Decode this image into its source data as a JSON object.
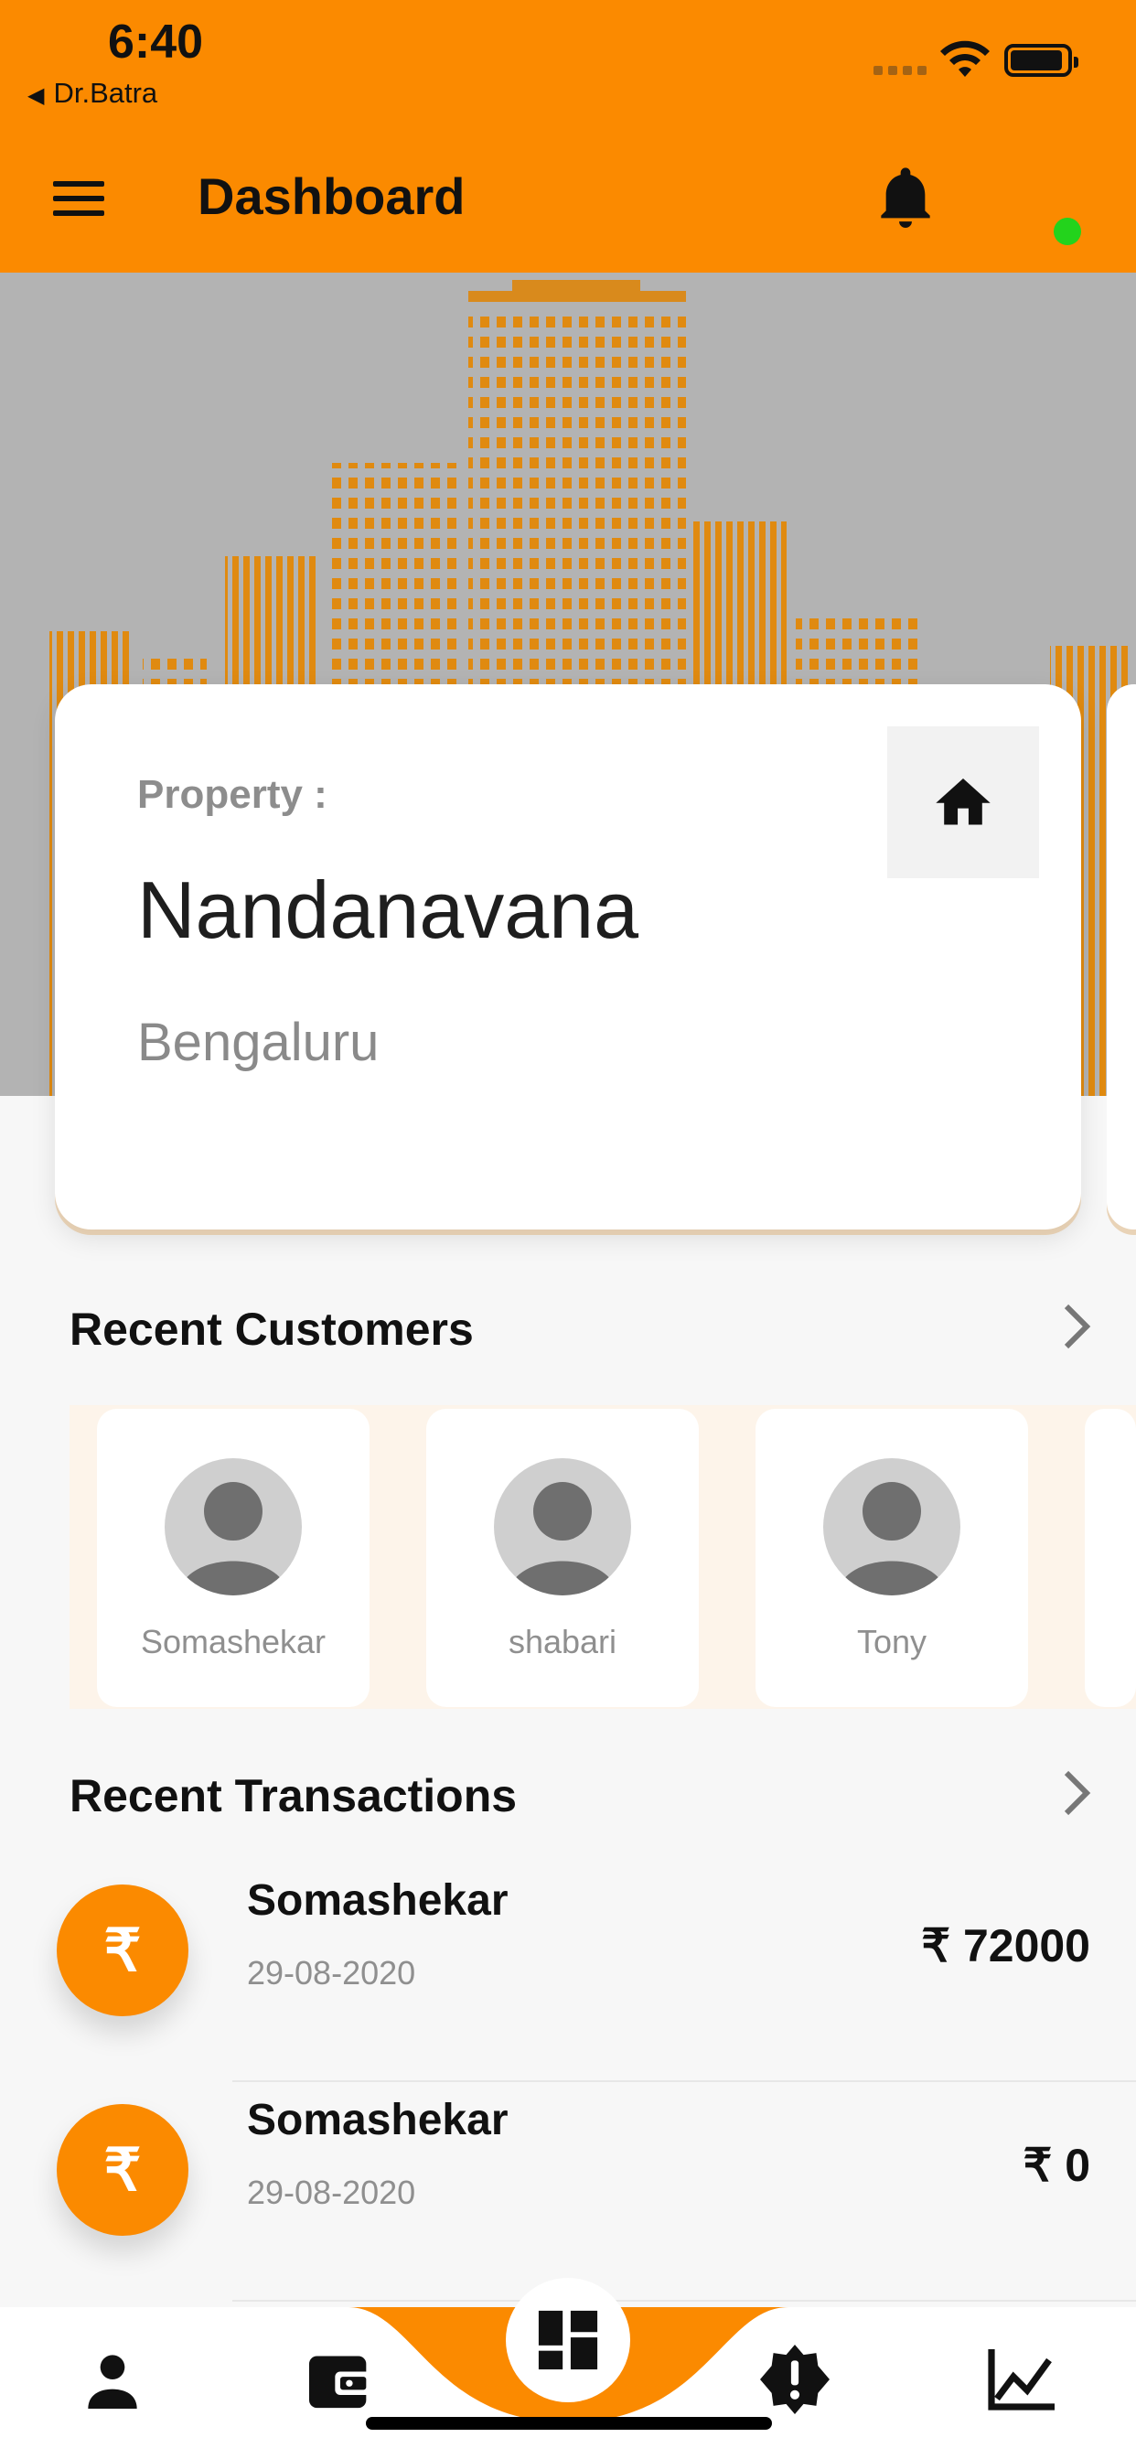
{
  "status_bar": {
    "time": "6:40",
    "back_app": "Dr.Batra"
  },
  "app_bar": {
    "title": "Dashboard"
  },
  "colors": {
    "accent": "#fb8a00",
    "online": "#23d31c"
  },
  "property_card": {
    "label": "Property :",
    "name": "Nandanavana",
    "city": "Bengaluru"
  },
  "recent_customers": {
    "title": "Recent Customers",
    "items": [
      {
        "name": "Somashekar"
      },
      {
        "name": "shabari"
      },
      {
        "name": "Tony"
      }
    ]
  },
  "recent_transactions": {
    "title": "Recent Transactions",
    "currency_icon": "₹",
    "items": [
      {
        "name": "Somashekar",
        "date": "29-08-2020",
        "amount": "₹ 72000"
      },
      {
        "name": "Somashekar",
        "date": "29-08-2020",
        "amount": "₹ 0"
      }
    ]
  },
  "icons": {
    "menu": "menu-icon",
    "notifications": "bell-icon",
    "property": "home-icon",
    "more": "chevron-right-icon",
    "nav": [
      "person-icon",
      "wallet-icon",
      "dashboard-icon",
      "alert-icon",
      "chart-icon"
    ]
  }
}
